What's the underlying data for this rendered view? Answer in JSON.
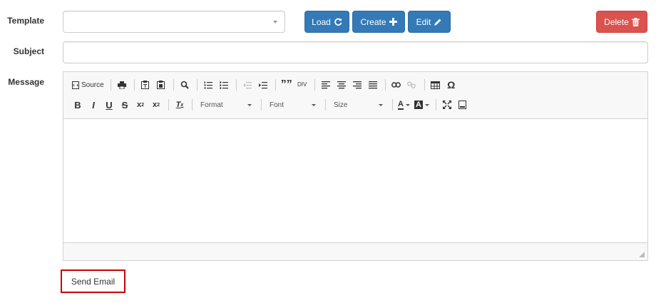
{
  "labels": {
    "template": "Template",
    "subject": "Subject",
    "message": "Message"
  },
  "template_select": {
    "selected": ""
  },
  "buttons": {
    "load": "Load",
    "create": "Create",
    "edit": "Edit",
    "delete": "Delete",
    "send_email": "Send Email"
  },
  "subject_input": {
    "value": ""
  },
  "editor": {
    "source_label": "Source",
    "format_label": "Format",
    "font_label": "Font",
    "size_label": "Size",
    "bold": "B",
    "italic": "I",
    "underline": "U",
    "strike": "S",
    "text_color": "A",
    "bg_color": "A",
    "special_char": "Ω"
  },
  "colors": {
    "primary": "#337ab7",
    "danger": "#d9534f",
    "highlight_border": "#cc0000"
  }
}
